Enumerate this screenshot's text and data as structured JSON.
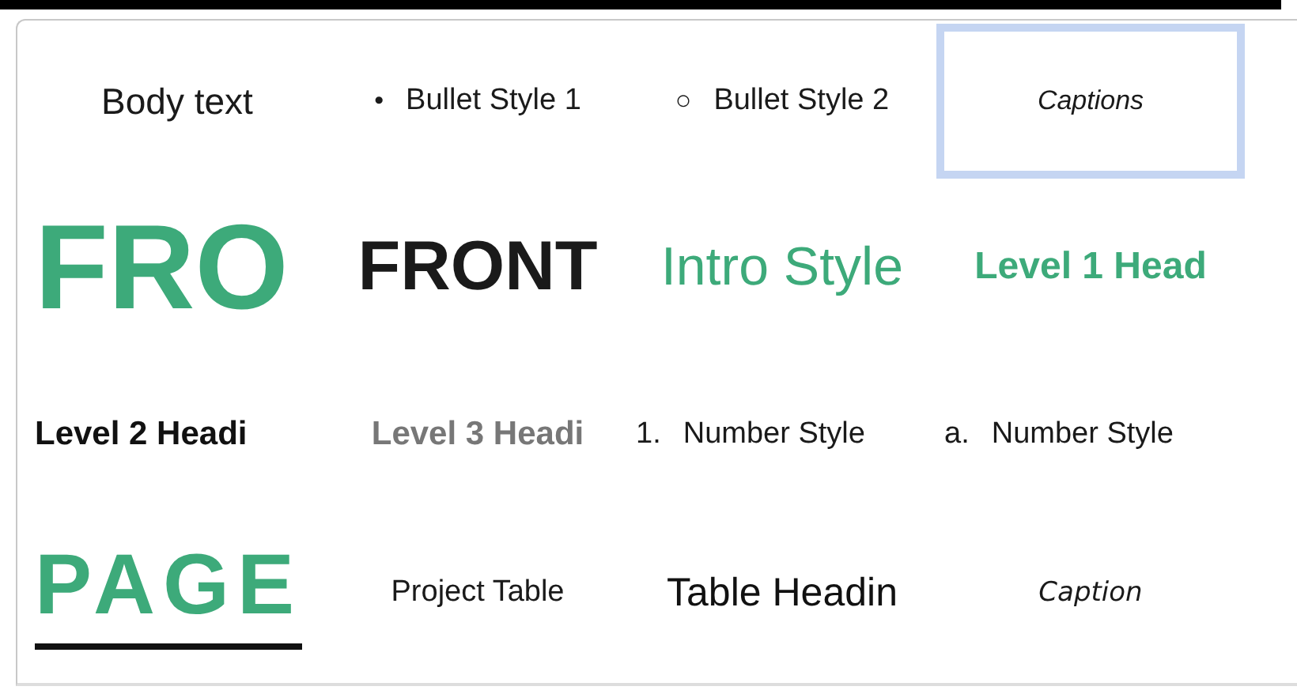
{
  "styles": [
    {
      "kind": "body",
      "label": "Body text",
      "selected": false
    },
    {
      "kind": "bullet",
      "marker": "•",
      "label": "Bullet Style 1",
      "selected": false
    },
    {
      "kind": "bullet",
      "marker": "○",
      "label": "Bullet Style 2",
      "selected": false
    },
    {
      "kind": "caption",
      "label": "Captions",
      "selected": true
    },
    {
      "kind": "cover",
      "label": "FRO",
      "selected": false
    },
    {
      "kind": "front",
      "label": "FRONT",
      "selected": false
    },
    {
      "kind": "intro",
      "label": "Intro Style",
      "selected": false
    },
    {
      "kind": "heading1",
      "label": "Level 1 Head",
      "selected": false
    },
    {
      "kind": "heading2",
      "label": "Level 2 Headi",
      "selected": false
    },
    {
      "kind": "heading3",
      "label": "Level 3 Headi",
      "selected": false
    },
    {
      "kind": "number",
      "marker": "1.",
      "label": "Number Style",
      "selected": false
    },
    {
      "kind": "number",
      "marker": "a.",
      "label": "Number Style",
      "selected": false
    },
    {
      "kind": "page",
      "label": "PAGE",
      "selected": false
    },
    {
      "kind": "plain",
      "label": "Project Table",
      "selected": false
    },
    {
      "kind": "table-heading",
      "label": "Table Headin",
      "selected": false
    },
    {
      "kind": "caption2",
      "label": "Caption",
      "selected": false
    }
  ]
}
